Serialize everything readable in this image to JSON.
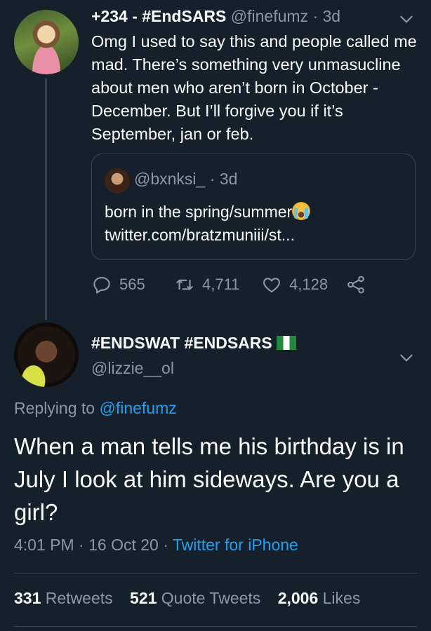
{
  "colors": {
    "background": "#15202b",
    "muted": "#8899a6",
    "link": "#1da1f2",
    "border": "#38444d",
    "text": "#ffffff"
  },
  "parent_tweet": {
    "display_name": "+234 - #EndSARS",
    "handle": "@finefumz",
    "time": "· 3d",
    "text": "Omg I used to say this and people called me mad. There’s something very unmasucline about men who aren’t born in October - December. But I’ll forgive you if it’s September, jan or feb.",
    "quoted": {
      "handle": "@bxnksi_",
      "time": "· 3d",
      "text": "born in the spring/summer",
      "link": "twitter.com/bratzmuniii/st..."
    },
    "replies": "565",
    "retweets": "4,711",
    "likes": "4,128",
    "icons": {
      "reply": "reply-icon",
      "retweet": "retweet-icon",
      "like": "heart-icon",
      "share": "share-icon",
      "more": "chevron-down-icon"
    }
  },
  "main_tweet": {
    "display_name": "#ENDSWAT #ENDSARS",
    "handle": "@lizzie__ol",
    "replying_prefix": "Replying to",
    "replying_handle": "@finefumz",
    "text": "When a man tells me his birthday is in July I look at him sideways. Are you a girl?",
    "time": "4:01 PM",
    "date": "· 16 Oct 20 ·",
    "source": "Twitter for iPhone",
    "retweets_count": "331",
    "retweets_label": "Retweets",
    "quote_count": "521",
    "quote_label": "Quote Tweets",
    "likes_count": "2,006",
    "likes_label": "Likes"
  }
}
